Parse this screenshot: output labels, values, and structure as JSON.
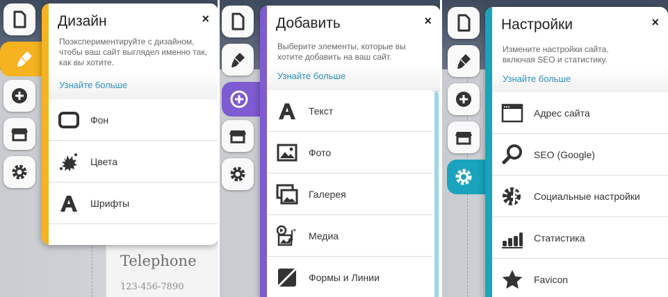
{
  "colors": {
    "design_accent": "#f4b31f",
    "add_accent": "#7e5bd1",
    "settings_accent": "#1aa3bd",
    "link": "#2b8fc1"
  },
  "design_panel": {
    "title": "Дизайн",
    "close": "×",
    "description_part1": "Поэкспериментируйте с дизайном, чтобы ваш сайт выглядел именно так, как ",
    "description_italic": "вы",
    "description_part2": " хотите.",
    "learn_more": "Узнайте больше",
    "items": [
      {
        "label": "Фон",
        "icon": "background-frame-icon"
      },
      {
        "label": "Цвета",
        "icon": "paint-splash-icon"
      },
      {
        "label": "Шрифты",
        "icon": "font-a-icon"
      }
    ]
  },
  "add_panel": {
    "title": "Добавить",
    "close": "×",
    "description": "Выберите элементы, которые вы хотите добавить на ваш сайт.",
    "learn_more": "Узнайте больше",
    "items": [
      {
        "label": "Текст",
        "icon": "text-a-icon"
      },
      {
        "label": "Фото",
        "icon": "photo-icon"
      },
      {
        "label": "Галерея",
        "icon": "gallery-icon"
      },
      {
        "label": "Медиа",
        "icon": "media-icon"
      },
      {
        "label": "Формы и Линии",
        "icon": "shapes-icon"
      }
    ]
  },
  "settings_panel": {
    "title": "Настройки",
    "close": "×",
    "description": "Измените настройки сайта, включая SEO и статистику.",
    "learn_more": "Узнайте больше",
    "items": [
      {
        "label": "Адрес сайта",
        "icon": "browser-window-icon"
      },
      {
        "label": "SEO (Google)",
        "icon": "magnifier-icon"
      },
      {
        "label": "Социальные настройки",
        "icon": "social-gear-icon"
      },
      {
        "label": "Статистика",
        "icon": "bar-stats-icon"
      },
      {
        "label": "Favicon",
        "icon": "star-icon"
      }
    ]
  },
  "background_page": {
    "heading": "Telephone",
    "phone": "123-456-7890"
  }
}
